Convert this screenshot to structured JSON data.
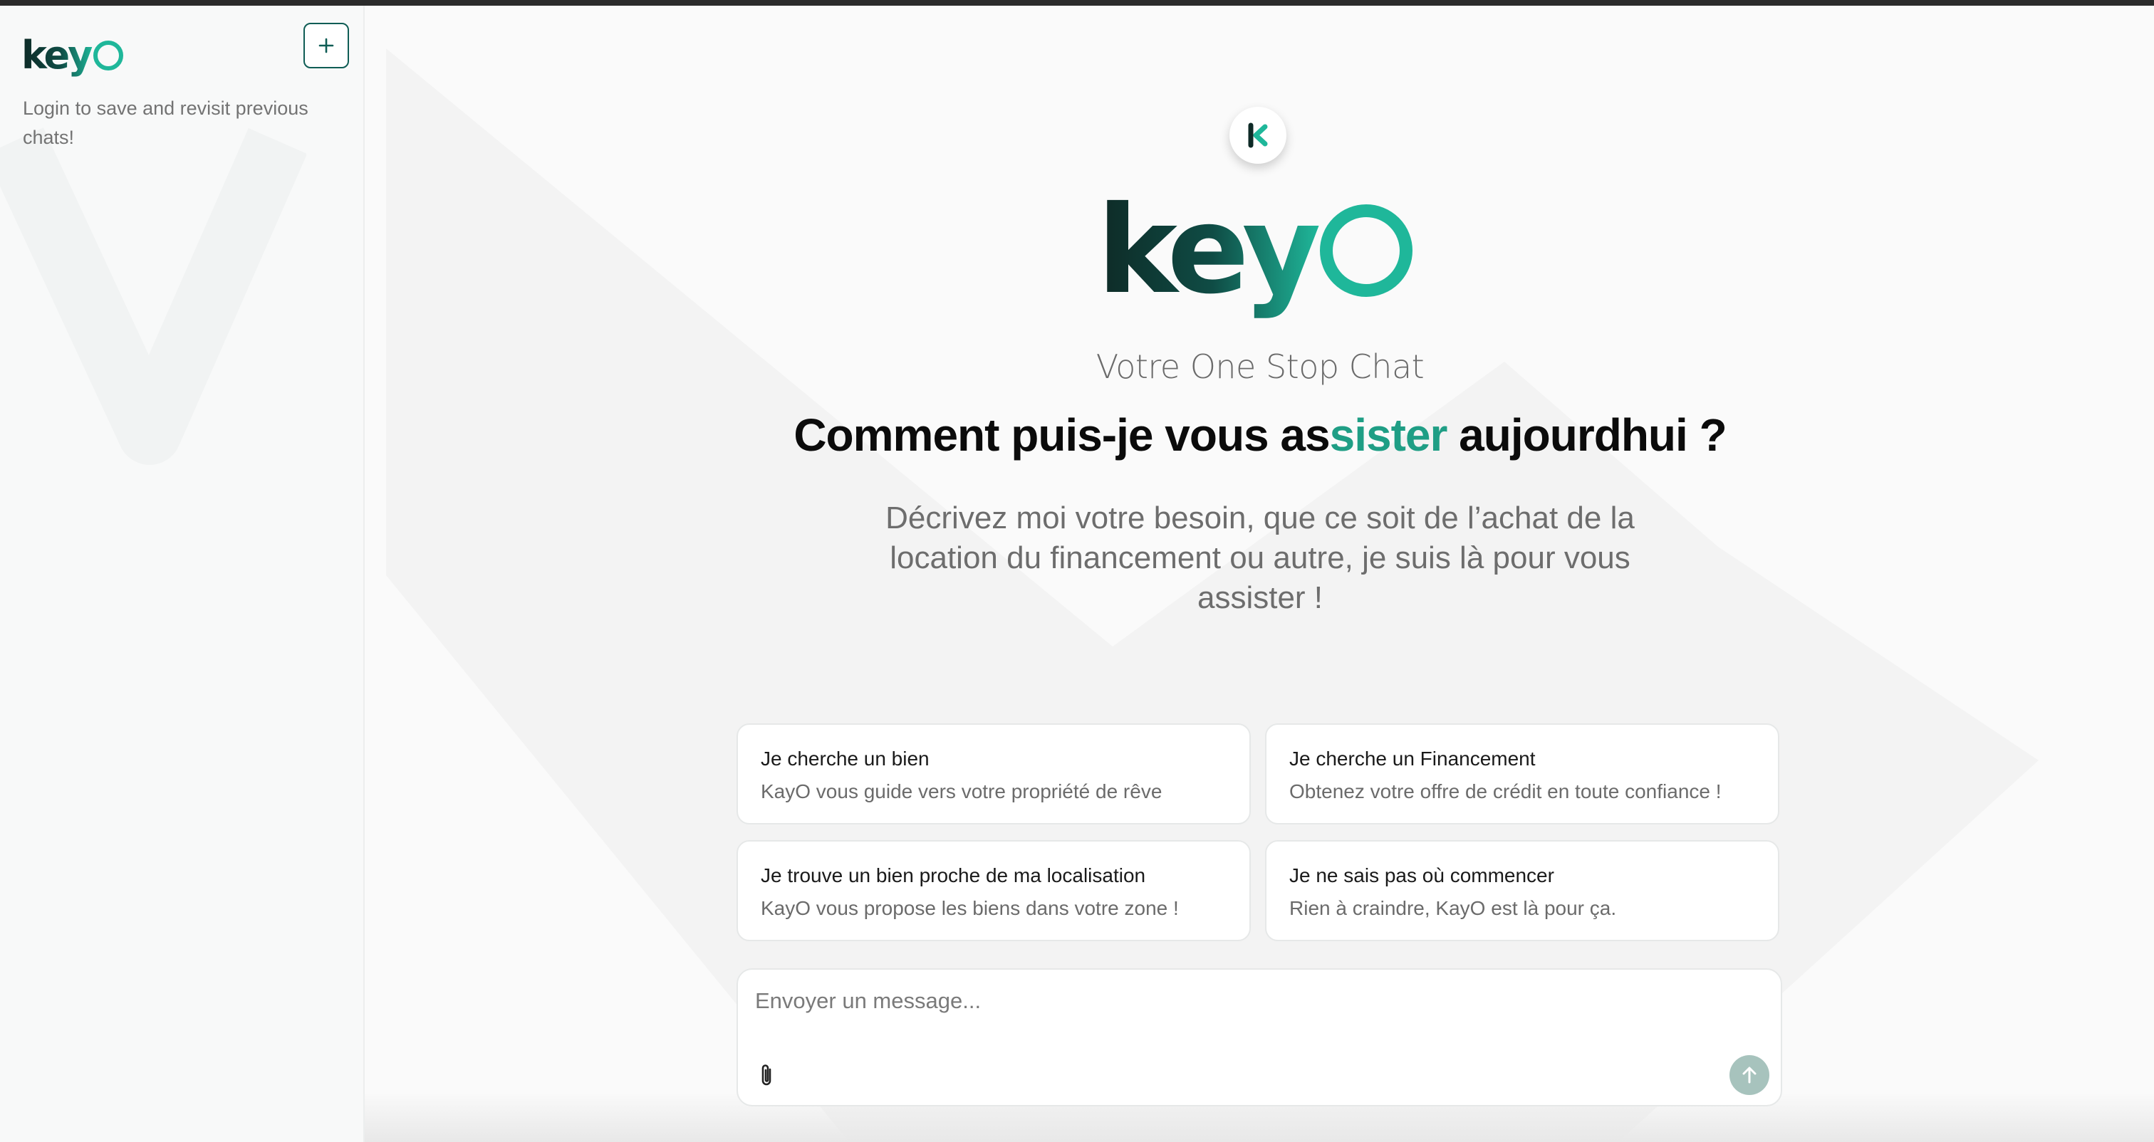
{
  "brand": {
    "name": "keyO",
    "dark_color": "#0e2a26",
    "accent_color": "#1fb79a"
  },
  "sidebar": {
    "logo_text": "keyO",
    "new_chat_icon": "plus-icon",
    "toggle_icon": "sidebar-panel-icon",
    "note": "Login to save and revisit previous chats!"
  },
  "hero": {
    "avatar_letter": "K",
    "logo_text": "keyO",
    "tagline": "Votre One Stop Chat",
    "headline_part1": "Comment puis-je vous as",
    "headline_highlight": "sister",
    "headline_part2": " aujourdhui ?",
    "description": "Décrivez moi votre besoin, que ce soit de l’achat de la location du financement ou autre, je suis là pour vous assister !"
  },
  "suggestions": [
    {
      "title": "Je cherche un bien",
      "subtitle": "KayO vous guide vers votre propriété de rêve"
    },
    {
      "title": "Je cherche un Financement",
      "subtitle": "Obtenez votre offre de crédit en toute confiance !"
    },
    {
      "title": "Je trouve un bien proche de ma localisation",
      "subtitle": "KayO vous propose les biens dans votre zone !"
    },
    {
      "title": "Je ne sais pas où commencer",
      "subtitle": "Rien à craindre, KayO est là pour ça."
    }
  ],
  "composer": {
    "placeholder": "Envoyer un message...",
    "value": "",
    "attach_icon": "paperclip-icon",
    "send_icon": "arrow-up-icon"
  }
}
